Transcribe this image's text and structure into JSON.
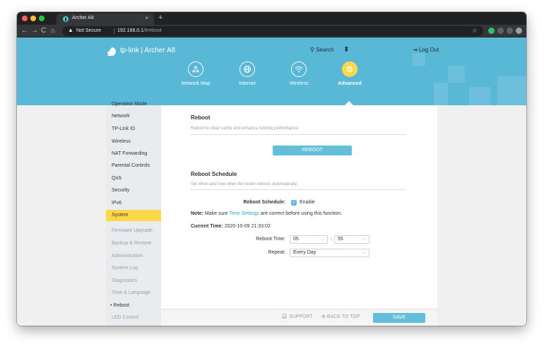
{
  "browser": {
    "tab_title": "Archer A8",
    "tab_close": "×",
    "new_tab": "+",
    "security_label": "Not Secure",
    "url_host": "192.168.0.1",
    "url_path": "/#reboot"
  },
  "header": {
    "logo_text": "tp-link",
    "model": "Archer A8",
    "search_label": "Search",
    "logout_label": "Log Out"
  },
  "nav": {
    "items": [
      {
        "label": "Network Map",
        "icon": "network-map-icon"
      },
      {
        "label": "Internet",
        "icon": "globe-icon"
      },
      {
        "label": "Wireless",
        "icon": "wifi-icon"
      },
      {
        "label": "Advanced",
        "icon": "gear-icon",
        "active": true
      }
    ]
  },
  "sidebar": {
    "items": [
      {
        "label": "Operation Mode"
      },
      {
        "label": "Network"
      },
      {
        "label": "TP-Link ID"
      },
      {
        "label": "Wireless"
      },
      {
        "label": "NAT Forwarding"
      },
      {
        "label": "Parental Controls"
      },
      {
        "label": "QoS"
      },
      {
        "label": "Security"
      },
      {
        "label": "IPv6"
      },
      {
        "label": "System",
        "active": true
      }
    ],
    "sub_items": [
      {
        "label": "Firmware Upgrade"
      },
      {
        "label": "Backup & Restore"
      },
      {
        "label": "Administration"
      },
      {
        "label": "System Log"
      },
      {
        "label": "Diagnostics"
      },
      {
        "label": "Time & Language"
      },
      {
        "label": "• Reboot",
        "selected": true
      },
      {
        "label": "LED Control"
      }
    ]
  },
  "reboot": {
    "title": "Reboot",
    "description": "Reboot to clear cache and enhance running performance.",
    "button_label": "REBOOT"
  },
  "schedule": {
    "title": "Reboot Schedule",
    "description": "Set when and how often the router reboots automatically.",
    "schedule_label": "Reboot Schedule:",
    "enable_label": "Enable",
    "enabled": true,
    "note_bold": "Note:",
    "note_pre": "Make sure",
    "note_link": "Time Settings",
    "note_post": "are correct before using this function.",
    "current_time_label": "Current Time:",
    "current_time_value": "2020-10-09 21:33:02",
    "reboot_time_label": "Reboot Time:",
    "hour": "05",
    "time_sep": ":",
    "minute": "55",
    "repeat_label": "Repeat:",
    "repeat_value": "Every Day"
  },
  "footer": {
    "support_label": "SUPPORT",
    "back_to_top_label": "BACK TO TOP",
    "save_label": "SAVE"
  },
  "colors": {
    "accent": "#62bfd9",
    "header_bg": "#58b8d6",
    "active_nav": "#ffd84a"
  }
}
